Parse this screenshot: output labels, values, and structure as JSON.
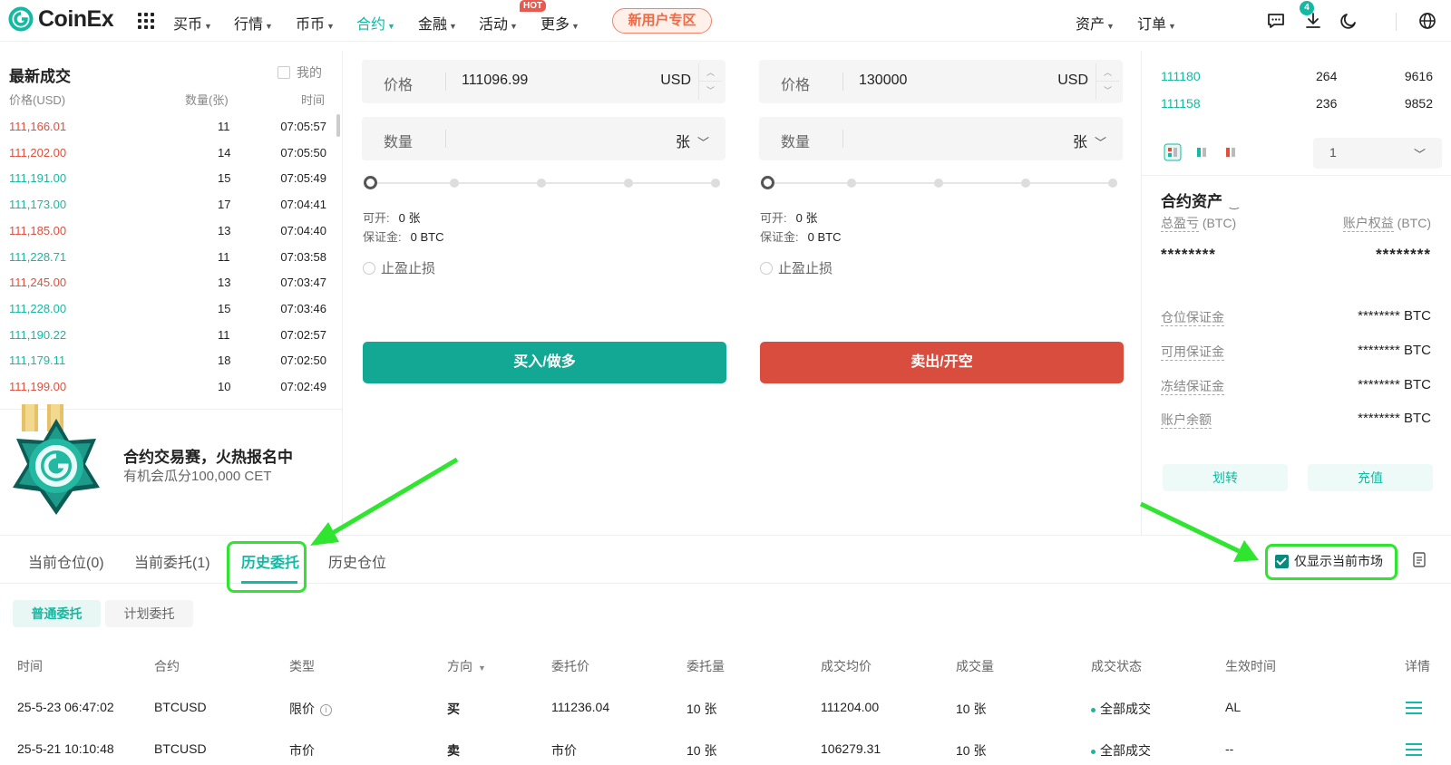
{
  "header": {
    "logo_text": "CoinEx",
    "nav": [
      {
        "label": "买币"
      },
      {
        "label": "行情"
      },
      {
        "label": "币币"
      },
      {
        "label": "合约"
      },
      {
        "label": "金融"
      },
      {
        "label": "活动"
      },
      {
        "label": "更多"
      }
    ],
    "hot_badge": "HOT",
    "new_user": "新用户专区",
    "assets": "资产",
    "orders": "订单",
    "msg_count": "4"
  },
  "trades": {
    "title": "最新成交",
    "mine_label": "我的",
    "col_price": "价格(USD)",
    "col_qty": "数量(张)",
    "col_time": "时间",
    "rows": [
      {
        "price": "111,166.01",
        "qty": "11",
        "time": "07:05:57",
        "side": "down"
      },
      {
        "price": "111,202.00",
        "qty": "14",
        "time": "07:05:50",
        "side": "down"
      },
      {
        "price": "111,191.00",
        "qty": "15",
        "time": "07:05:49",
        "side": "up"
      },
      {
        "price": "111,173.00",
        "qty": "17",
        "time": "07:04:41",
        "side": "up"
      },
      {
        "price": "111,185.00",
        "qty": "13",
        "time": "07:04:40",
        "side": "down"
      },
      {
        "price": "111,228.71",
        "qty": "11",
        "time": "07:03:58",
        "side": "up"
      },
      {
        "price": "111,245.00",
        "qty": "13",
        "time": "07:03:47",
        "side": "down"
      },
      {
        "price": "111,228.00",
        "qty": "15",
        "time": "07:03:46",
        "side": "up"
      },
      {
        "price": "111,190.22",
        "qty": "11",
        "time": "07:02:57",
        "side": "up"
      },
      {
        "price": "111,179.11",
        "qty": "18",
        "time": "07:02:50",
        "side": "up"
      },
      {
        "price": "111,199.00",
        "qty": "10",
        "time": "07:02:49",
        "side": "down"
      }
    ]
  },
  "promo": {
    "title": "合约交易赛，火热报名中",
    "subtitle": "有机会瓜分100,000 CET"
  },
  "order_form": {
    "price_label": "价格",
    "qty_label": "数量",
    "unit_usd": "USD",
    "unit_zhang": "张",
    "buy": {
      "price_value": "111096.99",
      "available_label": "可开:",
      "available_value": "0 张",
      "margin_label": "保证金:",
      "margin_value": "0 BTC",
      "tpsl_label": "止盈止损",
      "button": "买入/做多"
    },
    "sell": {
      "price_value": "130000",
      "available_label": "可开:",
      "available_value": "0 张",
      "margin_label": "保证金:",
      "margin_value": "0 BTC",
      "tpsl_label": "止盈止损",
      "button": "卖出/开空"
    }
  },
  "orderbook": {
    "rows": [
      {
        "price": "111180",
        "qty": "264",
        "total": "9616"
      },
      {
        "price": "111158",
        "qty": "236",
        "total": "9852"
      }
    ],
    "depth_select": "1"
  },
  "account": {
    "title": "合约资产",
    "total_pnl_label": "总盈亏",
    "total_pnl_unit": "(BTC)",
    "equity_label": "账户权益",
    "equity_unit": "(BTC)",
    "masked": "********",
    "rows": [
      {
        "label": "仓位保证金",
        "value": "******** BTC"
      },
      {
        "label": "可用保证金",
        "value": "******** BTC"
      },
      {
        "label": "冻结保证金",
        "value": "******** BTC"
      },
      {
        "label": "账户余额",
        "value": "******** BTC"
      }
    ],
    "transfer": "划转",
    "deposit": "充值"
  },
  "bottom": {
    "tabs": [
      "当前仓位(0)",
      "当前委托(1)",
      "历史委托",
      "历史仓位"
    ],
    "only_current_market": "仅显示当前市场",
    "subtabs": [
      "普通委托",
      "计划委托"
    ],
    "columns": [
      "时间",
      "合约",
      "类型",
      "方向",
      "委托价",
      "委托量",
      "成交均价",
      "成交量",
      "成交状态",
      "生效时间",
      "详情"
    ],
    "rows": [
      {
        "time": "25-5-23 06:47:02",
        "contract": "BTCUSD",
        "type": "限价",
        "side": "买",
        "side_class": "up",
        "price": "111236.04",
        "qty": "10 张",
        "avg": "111204.00",
        "filled": "10 张",
        "status": "全部成交",
        "effective": "AL"
      },
      {
        "time": "25-5-21 10:10:48",
        "contract": "BTCUSD",
        "type": "市价",
        "side": "卖",
        "side_class": "down",
        "price": "市价",
        "qty": "10 张",
        "avg": "106279.31",
        "filled": "10 张",
        "status": "全部成交",
        "effective": "--"
      }
    ]
  },
  "colors": {
    "accent": "#13b9a2",
    "sell": "#e34d3b",
    "highlight": "#2fe52f"
  }
}
